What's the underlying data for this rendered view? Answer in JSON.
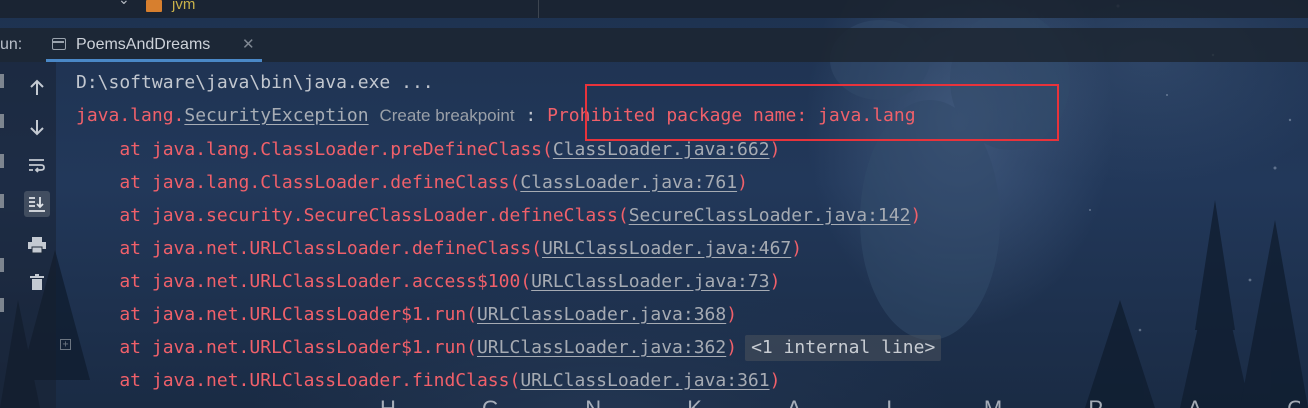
{
  "project_tree": {
    "folder_label": "jvm"
  },
  "run_panel": {
    "label": "un:",
    "tab_label": "PoemsAndDreams"
  },
  "console": {
    "command_line": "D:\\software\\java\\bin\\java.exe ...",
    "exception": {
      "prefix": "java.lang.",
      "class_link": "SecurityException",
      "hint": "Create breakpoint",
      "separator": " : ",
      "message": "Prohibited package name: java.lang"
    },
    "frames": [
      {
        "text": "    at java.lang.ClassLoader.preDefineClass(",
        "link": "ClassLoader.java:662",
        "suffix": ")"
      },
      {
        "text": "    at java.lang.ClassLoader.defineClass(",
        "link": "ClassLoader.java:761",
        "suffix": ")"
      },
      {
        "text": "    at java.security.SecureClassLoader.defineClass(",
        "link": "SecureClassLoader.java:142",
        "suffix": ")"
      },
      {
        "text": "    at java.net.URLClassLoader.defineClass(",
        "link": "URLClassLoader.java:467",
        "suffix": ")"
      },
      {
        "text": "    at java.net.URLClassLoader.access$100(",
        "link": "URLClassLoader.java:73",
        "suffix": ")"
      },
      {
        "text": "    at java.net.URLClassLoader$1.run(",
        "link": "URLClassLoader.java:368",
        "suffix": ")"
      },
      {
        "text": "    at java.net.URLClassLoader$1.run(",
        "link": "URLClassLoader.java:362",
        "suffix": ")",
        "folded": "<1 internal line>"
      },
      {
        "text": "    at java.net.URLClassLoader.findClass(",
        "link": "URLClassLoader.java:361",
        "suffix": ")"
      }
    ]
  },
  "toolbar_icons": [
    "arrow-up-icon",
    "arrow-down-icon",
    "soft-wrap-icon",
    "scroll-to-end-icon",
    "print-icon",
    "trash-icon"
  ],
  "background_letters": "H G N K A L M P A G T S",
  "colors": {
    "error_text": "#f0606a",
    "command_text": "#c2c7cf",
    "highlight_border": "#e8333b",
    "tab_underline": "#4a88c7"
  }
}
